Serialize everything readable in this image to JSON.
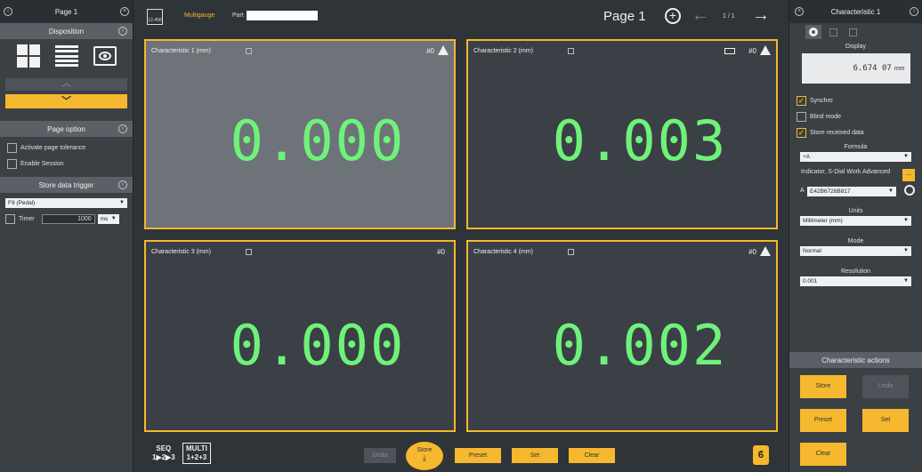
{
  "left_panel": {
    "title": "Page 1",
    "disposition_label": "Disposition",
    "page_option_label": "Page option",
    "activate_tolerance_label": "Activate page tolerance",
    "enable_session_label": "Enable Session",
    "store_trigger_label": "Store data trigger",
    "trigger_select": "F9 (Pedal)",
    "timer_label": "Timer",
    "timer_value": "1000",
    "timer_unit": "ms"
  },
  "topbar": {
    "logo_text": "12.456",
    "app_name": "Multigauge",
    "part_label": "Part",
    "part_value": "",
    "page_label": "Page 1",
    "page_counter": "1 / 1"
  },
  "characteristics": [
    {
      "title": "Characteristic 1  (mm)",
      "count": "#0",
      "value": "0.000"
    },
    {
      "title": "Characteristic 2  (mm)",
      "count": "#0",
      "value": "0.003"
    },
    {
      "title": "Characteristic 3  (mm)",
      "count": "#0",
      "value": "0.000"
    },
    {
      "title": "Characteristic 4  (mm)",
      "count": "#0",
      "value": "0.002"
    }
  ],
  "bottom": {
    "seq_label": "SEQ",
    "seq_sub": "1▶2▶3",
    "multi_label": "MULTI",
    "multi_sub": "1+2+3",
    "undo": "Undo",
    "store": "Store",
    "preset": "Preset",
    "set": "Set",
    "clear": "Clear"
  },
  "right_panel": {
    "title": "Characteristic 1",
    "display_label": "Display",
    "display_value": "6.674 07",
    "display_unit": "mm",
    "synchro_label": "Synchro",
    "blind_mode_label": "Blind mode",
    "store_received_label": "Store received data",
    "formula_label": "Formula",
    "formula_value": "+A",
    "device_label": "Indicator, S-Dial Work Advanced",
    "device_prefix": "A",
    "device_value": "E42B6728B817",
    "units_label": "Units",
    "units_value": "Millimeter (mm)",
    "mode_label": "Mode",
    "mode_value": "Normal",
    "resolution_label": "Resolution",
    "resolution_value": "0.001",
    "actions_label": "Characteristic actions",
    "store": "Store",
    "undo": "Undo",
    "preset": "Preset",
    "set": "Set",
    "clear": "Clear"
  },
  "colors": {
    "accent": "#f5b82e",
    "value_green": "#6ff279"
  }
}
